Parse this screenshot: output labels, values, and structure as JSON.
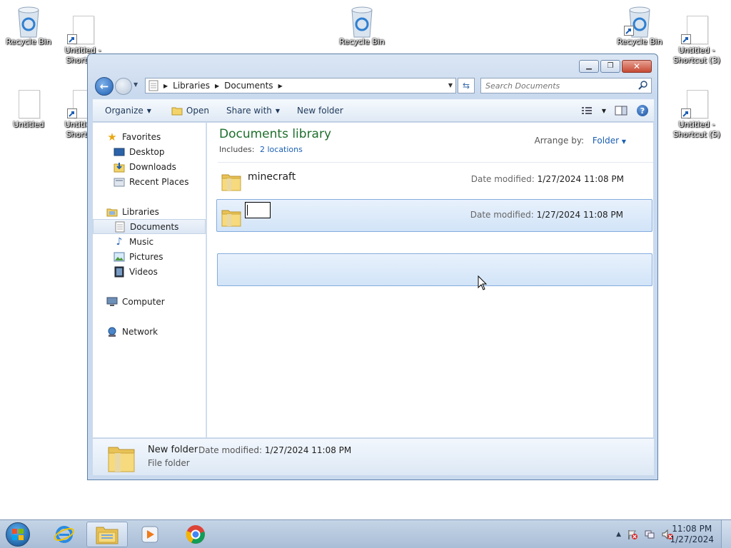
{
  "desktop": {
    "icons": [
      {
        "label": "Recycle Bin",
        "type": "recycle"
      },
      {
        "label": "Untitled - Shortcut",
        "type": "shortcut"
      },
      {
        "label": "Recycle Bin",
        "type": "recycle"
      },
      {
        "label": "Recycle Bin",
        "type": "recycle-shortcut"
      },
      {
        "label": "Untitled - Shortcut (3)",
        "type": "shortcut"
      },
      {
        "label": "Untitled",
        "type": "file"
      },
      {
        "label": "Untitled - Shortcut",
        "type": "shortcut"
      },
      {
        "label": "Untitled - Shortcut (5)",
        "type": "shortcut"
      }
    ]
  },
  "window": {
    "address": {
      "crumbs": [
        "Libraries",
        "Documents"
      ]
    },
    "search": {
      "placeholder": "Search Documents"
    },
    "toolbar": {
      "organize": "Organize",
      "open": "Open",
      "share_with": "Share with",
      "new_folder": "New folder"
    },
    "nav": {
      "favorites": "Favorites",
      "desktop": "Desktop",
      "downloads": "Downloads",
      "recent_places": "Recent Places",
      "libraries": "Libraries",
      "documents": "Documents",
      "music": "Music",
      "pictures": "Pictures",
      "videos": "Videos",
      "computer": "Computer",
      "network": "Network"
    },
    "library": {
      "title": "Documents library",
      "includes_label": "Includes:",
      "includes_link": "2 locations",
      "arrange_label": "Arrange by:",
      "arrange_value": "Folder"
    },
    "files": [
      {
        "name": "minecraft",
        "date_label": "Date modified:",
        "date": "1/27/2024 11:08 PM"
      },
      {
        "name": "",
        "date_label": "Date modified:",
        "date": "1/27/2024 11:08 PM",
        "renaming": true
      }
    ],
    "details": {
      "name": "New folder",
      "date_label": "Date modified:",
      "date": "1/27/2024 11:08 PM",
      "type": "File folder"
    }
  },
  "taskbar": {
    "apps": [
      "internet-explorer",
      "windows-explorer",
      "media-player",
      "chrome"
    ],
    "clock": {
      "time": "11:08 PM",
      "date": "1/27/2024"
    }
  }
}
